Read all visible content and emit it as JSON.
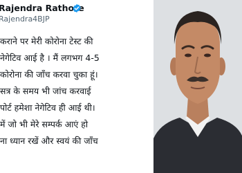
{
  "tweet": {
    "author_name": "Rajendra Rathore",
    "handle": "Rajendra4BJP",
    "verified_icon": "verified-badge-icon",
    "verified_color": "#1d9bf0",
    "lines": [
      "कराने पर मेरी कोरोना टेस्ट की",
      "नेगेटिव आई है । मैं लगभग 4-5",
      "कोरोना की जाँच करवा चुका हूं।",
      "सत्र के समय भी जांच करवाई",
      "पोर्ट हमेशा नेगेटिव ही आई थी।",
      "में जो भी मेरे सम्पर्क आएं हो",
      "ना ध्यान रखें और स्वयं की जाँच"
    ]
  },
  "photo": {
    "subject": "person-photo"
  }
}
